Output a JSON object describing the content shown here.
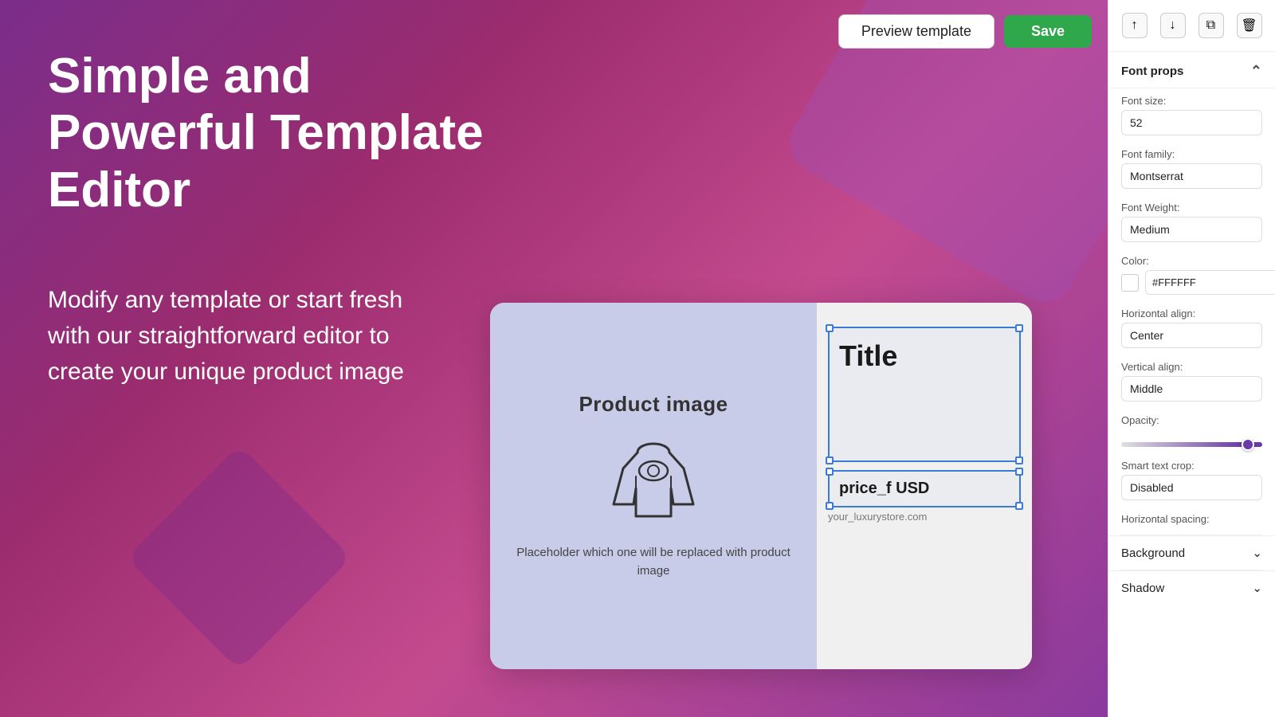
{
  "toolbar": {
    "preview_label": "Preview template",
    "save_label": "Save"
  },
  "hero": {
    "title": "Simple and Powerful Template Editor",
    "subtitle": "Modify any template or start fresh with our straightforward editor to create your unique product image"
  },
  "template": {
    "product_label": "Product image",
    "placeholder_text": "Placeholder which one will be replaced with product image",
    "title_element": "Title",
    "price_element": "price_f USD",
    "watermark": "your_luxurystore.com"
  },
  "right_panel": {
    "section_title": "Font props",
    "font_size_label": "Font size:",
    "font_size_value": "52",
    "font_family_label": "Font family:",
    "font_family_value": "Montserrat",
    "font_weight_label": "Font Weight:",
    "font_weight_value": "Medium",
    "color_label": "Color:",
    "color_value": "#FFFFFF",
    "horizontal_align_label": "Horizontal align:",
    "horizontal_align_value": "Center",
    "vertical_align_label": "Vertical align:",
    "vertical_align_value": "Middle",
    "opacity_label": "Opacity:",
    "smart_text_crop_label": "Smart text crop:",
    "smart_text_crop_value": "Disabled",
    "horizontal_spacing_label": "Horizontal spacing:",
    "background_label": "Background",
    "shadow_label": "Shadow",
    "icons": {
      "up": "↑",
      "down": "↓",
      "copy": "⧉",
      "delete": "🗑"
    }
  }
}
